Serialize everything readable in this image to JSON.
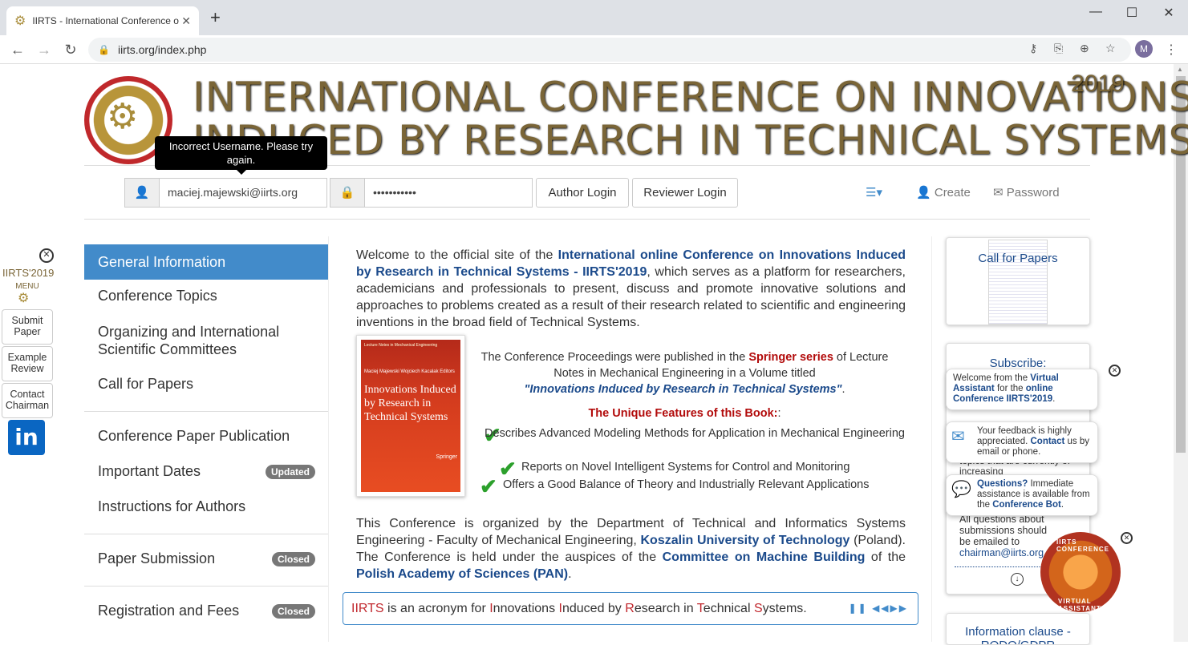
{
  "browser": {
    "tab_title": "IIRTS - International Conference o",
    "new_tab": "+",
    "url": "iirts.org/index.php",
    "avatar_initial": "M"
  },
  "header": {
    "banner_line1": "INTERNATIONAL CONFERENCE ON INNOVATIONS",
    "banner_line2": "INDUCED BY RESEARCH IN TECHNICAL SYSTEMS",
    "year": "2019"
  },
  "login": {
    "username": "maciej.majewski@iirts.org",
    "password": "•••••••••••",
    "author_login": "Author Login",
    "reviewer_login": "Reviewer Login",
    "create": "Create",
    "password_link": "Password",
    "tooltip": "Incorrect Username. Please try again."
  },
  "nav": [
    {
      "label": "General Information",
      "active": true
    },
    {
      "label": "Conference Topics"
    },
    {
      "label": "Organizing and International Scientific Committees"
    },
    {
      "label": "Call for Papers"
    },
    {
      "label": "Conference Paper Publication"
    },
    {
      "label": "Important Dates",
      "badge": "Updated"
    },
    {
      "label": "Instructions for Authors"
    },
    {
      "label": "Paper Submission",
      "badge": "Closed"
    },
    {
      "label": "Registration and Fees",
      "badge": "Closed"
    }
  ],
  "sidemenu": {
    "title": "IIRTS'2019",
    "subtitle": "MENU",
    "submit": "Submit Paper",
    "example": "Example Review",
    "contact": "Contact Chairman",
    "linkedin": "in"
  },
  "main": {
    "welcome_pre": "Welcome to the official site of the ",
    "welcome_link": "International online Conference on Innovations Induced by Research in Technical Systems - IIRTS'2019",
    "welcome_post": ", which serves as a platform for researchers, academicians and professionals to present, discuss and promote innovative solutions and approaches to problems created as a result of their research related to scientific and engineering inventions in the broad field of Technical Systems.",
    "book_series": "Lecture Notes in Mechanical Engineering",
    "book_authors": "Maciej Majewski Wojciech Kacalak Editors",
    "book_title": "Innovations Induced by Research in Technical Systems",
    "book_publisher": "Springer",
    "proc_pre": "The Conference Proceedings were published in the ",
    "proc_springer": "Springer series",
    "proc_mid": " of Lecture Notes in Mechanical Engineering in a Volume titled",
    "proc_title": "\"Innovations Induced by Research in Technical Systems\"",
    "proc_end": ".",
    "features_title": "The Unique Features of this Book:",
    "features_colon": ":",
    "feature1": "Describes Advanced Modeling Methods for Application in Mechanical Engineering",
    "feature2": "Reports on Novel Intelligent Systems for Control and Monitoring",
    "feature3": "Offers a Good Balance of Theory and Industrially Relevant Applications",
    "org_1": "This Conference is organized by the Department of Technical and Informatics Systems Engineering - Faculty of Mechanical Engineering, ",
    "org_univ": "Koszalin University of Technology",
    "org_2": " (Poland). The Conference is held under the auspices of the ",
    "org_committee": "Committee on Machine Building",
    "org_3": " of the ",
    "org_pan": "Polish Academy of Sciences (PAN)",
    "org_4": ".",
    "acr_iirts": "IIRTS",
    "acr_text": " is an acronym for ",
    "acr_I1": "I",
    "acr_w1": "nnovations ",
    "acr_I2": "I",
    "acr_w2": "nduced by ",
    "acr_R": "R",
    "acr_w3": "esearch in ",
    "acr_T": "T",
    "acr_w4": "echnical ",
    "acr_S": "S",
    "acr_w5": "ystems."
  },
  "right": {
    "cfp": "Call for Papers",
    "subscribe": "Subscribe:",
    "bubble1_pre": "Welcome from the ",
    "bubble1_va": "Virtual Assistant",
    "bubble1_mid": " for the ",
    "bubble1_conf": "online Conference IIRTS'2019",
    "bubble1_end": ".",
    "bubble2_pre": "Your feedback is highly appreciated. ",
    "bubble2_contact": "Contact",
    "bubble2_post": " us by email or phone.",
    "bubble3_q": "Questions?",
    "bubble3_mid": " Immediate assistance is available from the ",
    "bubble3_bot": "Conference Bot",
    "bubble3_end": ".",
    "hidden_text": "topics that are currently of increasing",
    "q_text": "All questions about submissions should be emailed to",
    "q_email": "chairman@iirts.org",
    "va_top": "IIRTS CONFERENCE",
    "va_bottom": "VIRTUAL ASSISTANT",
    "info_clause": "Information clause - RODO/GDPR"
  }
}
